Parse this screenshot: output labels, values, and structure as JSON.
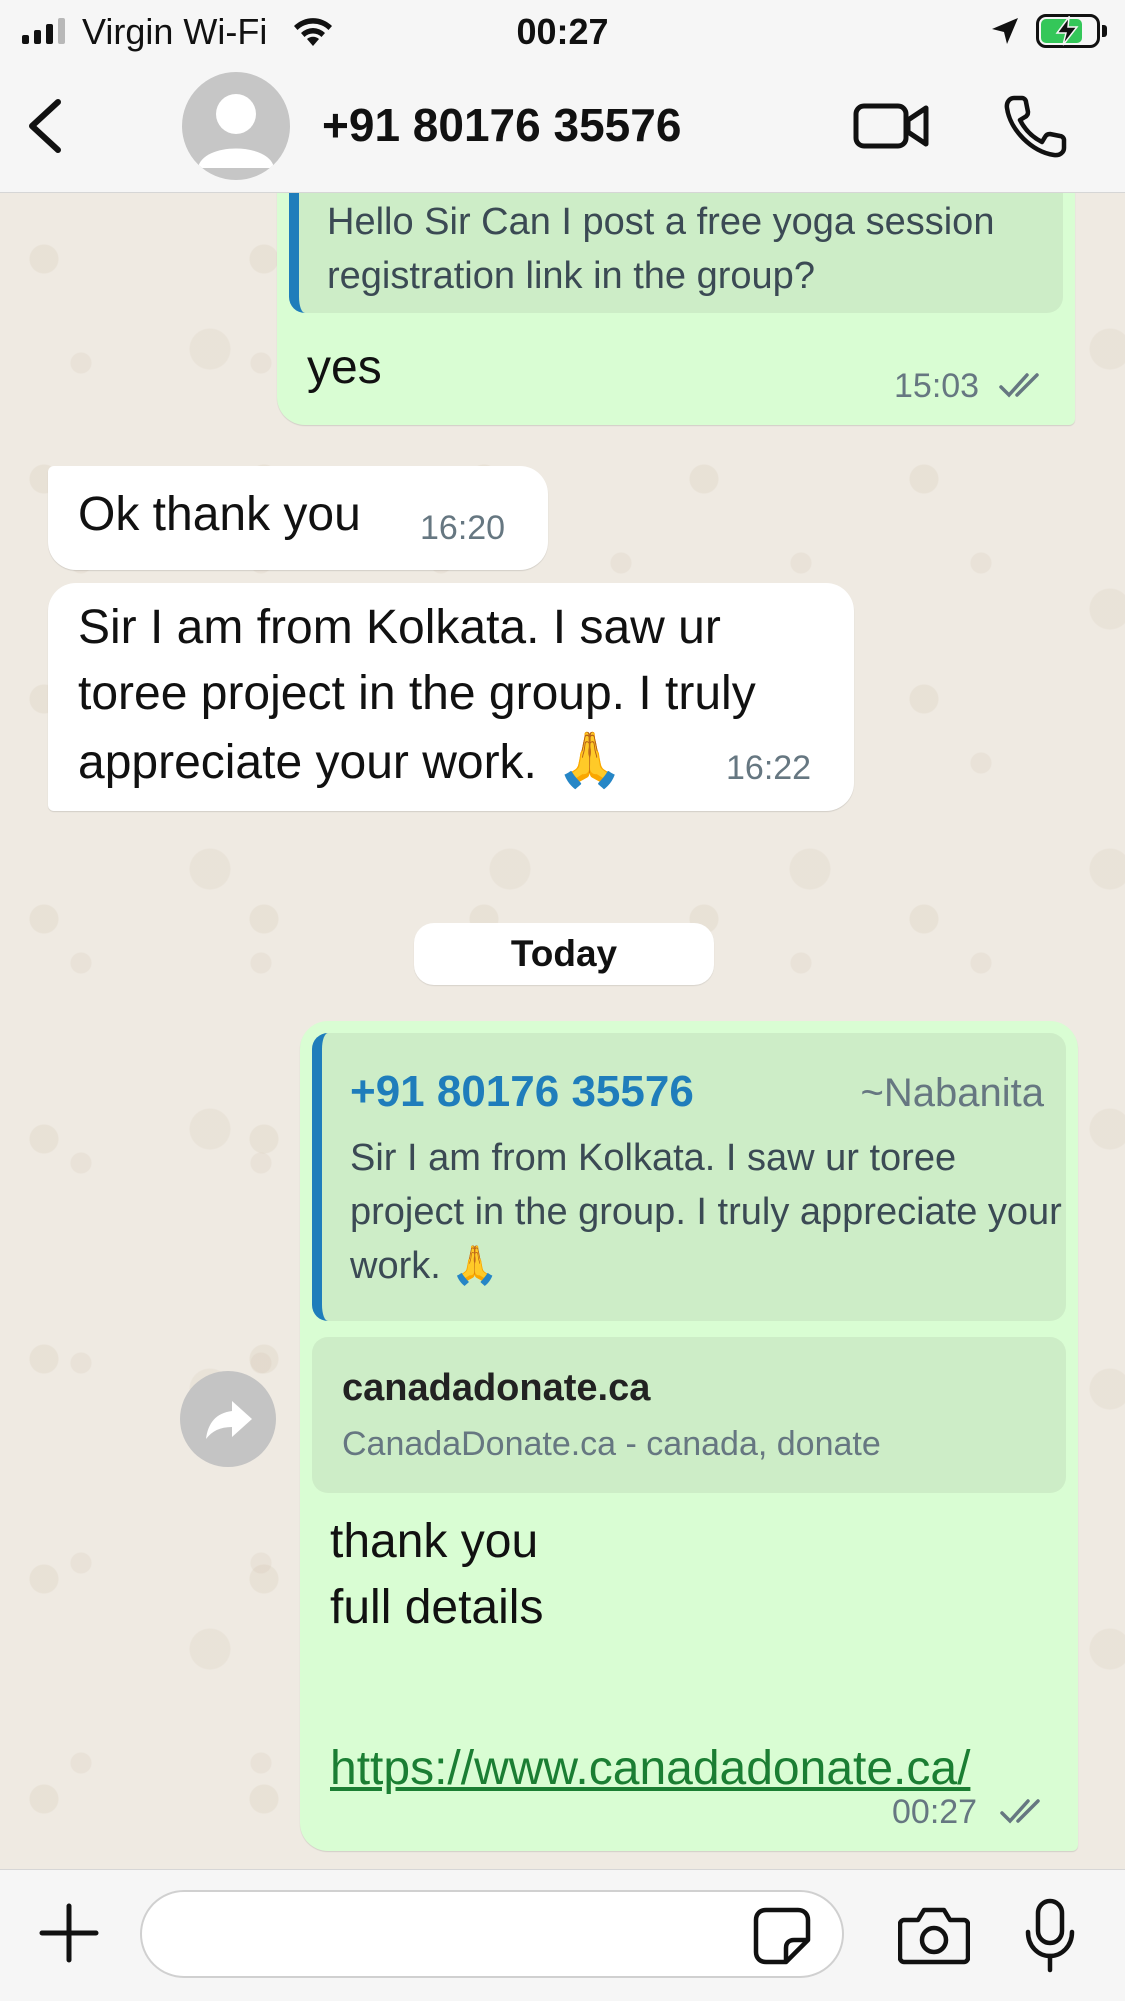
{
  "status_bar": {
    "carrier": "Virgin Wi-Fi",
    "time": "00:27",
    "battery_level": 0.75
  },
  "header": {
    "contact_name": "+91 80176 35576",
    "icons": [
      "back-chevron-icon",
      "avatar-placeholder-icon",
      "video-camera-icon",
      "phone-icon"
    ]
  },
  "chat": {
    "messages": [
      {
        "direction": "outgoing",
        "quoted_text": "Hello Sir Can I post a free yoga session registration link in the group?",
        "text": "yes",
        "time": "15:03",
        "status": "read"
      },
      {
        "direction": "incoming",
        "text": "Ok thank you",
        "time": "16:20"
      },
      {
        "direction": "incoming",
        "text": "Sir I am from Kolkata. I saw ur toree project in the group. I truly appreciate your work.",
        "emoji": "🙏",
        "time": "16:22"
      },
      {
        "direction": "outgoing",
        "quoted_author": "+91 80176 35576",
        "quoted_pushname": "~Nabanita",
        "quoted_text": "Sir I am from Kolkata. I saw ur toree project in the group. I truly appreciate your work.",
        "quoted_emoji": "🙏",
        "link_preview": {
          "domain": "canadadonate.ca",
          "description": "CanadaDonate.ca - canada, donate"
        },
        "text_lines": [
          "thank you",
          "full details",
          ""
        ],
        "url": "https://www.canadadonate.ca/",
        "time": "00:27",
        "status": "read"
      }
    ],
    "date_separator": "Today"
  },
  "input_bar": {
    "placeholder": ""
  },
  "colors": {
    "outgoing_bubble": "#d9fdd3",
    "incoming_bubble": "#ffffff",
    "quote_bar": "#1f7dbb",
    "link": "#1b7e33",
    "battery_fill": "#34c759"
  }
}
